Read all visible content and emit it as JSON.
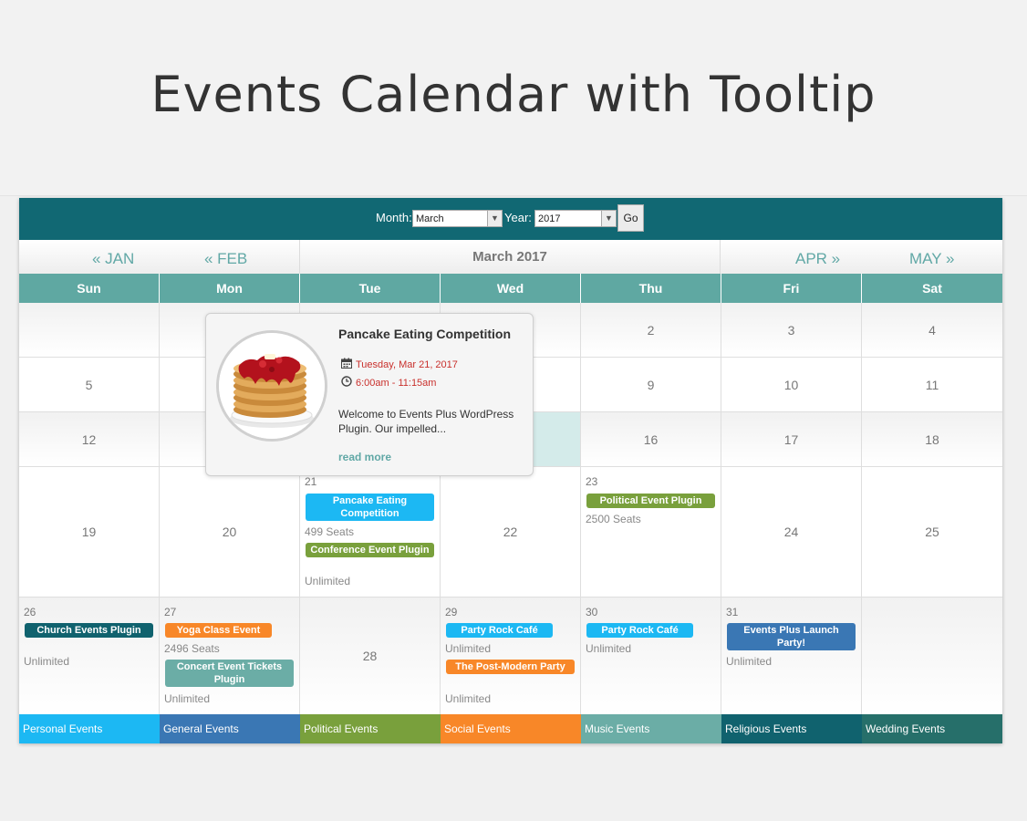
{
  "page": {
    "title": "Events Calendar with Tooltip"
  },
  "filter": {
    "month_label": "Month:",
    "month_value": "March",
    "year_label": "Year:",
    "year_value": "2017",
    "go_label": "Go"
  },
  "nav": {
    "prev2": "« JAN",
    "prev1": "« FEB",
    "current": "March 2017",
    "next1": "APR »",
    "next2": "MAY »"
  },
  "days": [
    "Sun",
    "Mon",
    "Tue",
    "Wed",
    "Thu",
    "Fri",
    "Sat"
  ],
  "weeks": {
    "w1": {
      "thu": "2",
      "fri": "3",
      "sat": "4"
    },
    "w2": {
      "sun": "5",
      "thu": "9",
      "fri": "10",
      "sat": "11"
    },
    "w3": {
      "sun": "12",
      "thu": "16",
      "fri": "17",
      "sat": "18"
    },
    "w4": {
      "sun": "19",
      "mon": "20",
      "tue": "21",
      "wed": "22",
      "thu": "23",
      "fri": "24",
      "sat": "25",
      "tue_events": [
        {
          "label": "Pancake Eating Competition",
          "meta": "499 Seats"
        },
        {
          "label": "Conference Event Plugin",
          "meta": "Unlimited"
        }
      ],
      "thu_events": [
        {
          "label": "Political Event Plugin",
          "meta": "2500 Seats"
        }
      ]
    },
    "w5": {
      "sun": "26",
      "mon": "27",
      "tue": "28",
      "wed": "29",
      "thu": "30",
      "fri": "31",
      "sun_events": [
        {
          "label": "Church Events Plugin",
          "meta": "Unlimited"
        }
      ],
      "mon_events": [
        {
          "label": "Yoga Class Event",
          "meta": "2496 Seats"
        },
        {
          "label": "Concert Event Tickets Plugin",
          "meta": "Unlimited"
        }
      ],
      "wed_events": [
        {
          "label": "Party Rock Café",
          "meta": "Unlimited"
        },
        {
          "label": "The Post-Modern Party",
          "meta": "Unlimited"
        }
      ],
      "thu_events": [
        {
          "label": "Party Rock Café",
          "meta": "Unlimited"
        }
      ],
      "fri_events": [
        {
          "label": "Events Plus Launch Party!",
          "meta": "Unlimited"
        }
      ]
    }
  },
  "legend": [
    "Personal Events",
    "General Events",
    "Political Events",
    "Social Events",
    "Music Events",
    "Religious Events",
    "Wedding Events"
  ],
  "colors": {
    "header": "#116873",
    "day_header": "#5fa8a2",
    "nav_link": "#61a8a6",
    "personal": "#1cb8f3",
    "general": "#3a77b4",
    "political": "#79a03c",
    "social": "#f88728",
    "music": "#6bada6",
    "religious": "#10626e",
    "wedding": "#266f6a",
    "tooltip_date": "#c9302c"
  },
  "tooltip": {
    "title": "Pancake Eating Competition",
    "date": "Tuesday, Mar 21, 2017",
    "time": "6:00am - 11:15am",
    "description": "Welcome to Events Plus WordPress Plugin. Our impelled...",
    "read_more": "read more",
    "image_icon": "pancake-stack-image",
    "date_icon": "calendar-icon",
    "time_icon": "clock-icon"
  }
}
